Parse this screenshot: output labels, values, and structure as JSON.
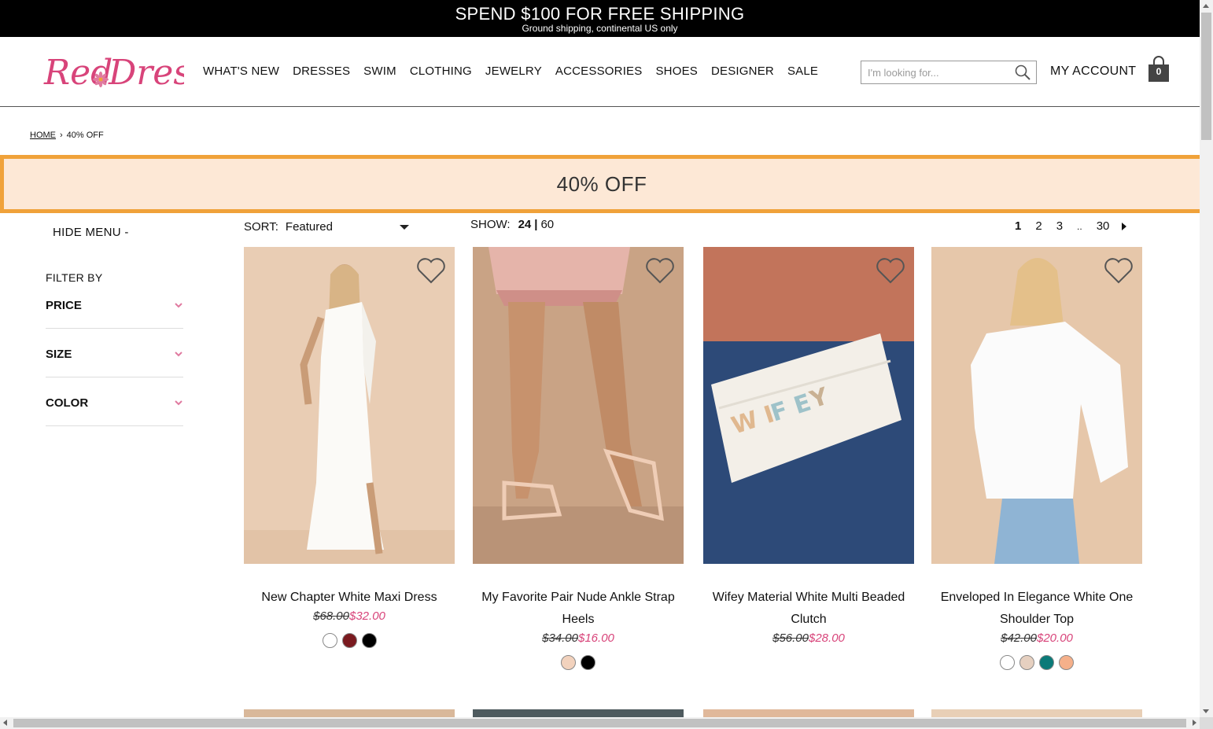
{
  "promo": {
    "headline": "SPEND $100 FOR FREE SHIPPING",
    "subline": "Ground shipping, continental US only"
  },
  "brand": {
    "logo_text": "Red Dress",
    "accent": "#d8447a"
  },
  "nav": [
    "WHAT'S NEW",
    "DRESSES",
    "SWIM",
    "CLOTHING",
    "JEWELRY",
    "ACCESSORIES",
    "SHOES",
    "DESIGNER",
    "SALE"
  ],
  "search": {
    "placeholder": "I'm looking for..."
  },
  "account": {
    "label": "MY ACCOUNT",
    "cart_count": "0"
  },
  "breadcrumb": {
    "home": "HOME",
    "separator": "›",
    "current": "40% OFF"
  },
  "banner": {
    "title": "40% OFF"
  },
  "sidebar": {
    "hide_menu": "HIDE MENU -",
    "filter_by": "FILTER BY",
    "facets": [
      "PRICE",
      "SIZE",
      "COLOR"
    ]
  },
  "toolbar": {
    "sort_label": "SORT:",
    "sort_value": "Featured",
    "show_label": "SHOW:",
    "show_options": [
      "24",
      "|",
      "60"
    ],
    "pages": [
      "1",
      "2",
      "3",
      "..",
      "30"
    ]
  },
  "products": [
    {
      "name": "New Chapter White Maxi Dress",
      "old_price": "$68.00",
      "price": "$32.00",
      "swatches": [
        "#ffffff",
        "#7a1a1f",
        "#000000"
      ]
    },
    {
      "name": "My Favorite Pair Nude Ankle Strap Heels",
      "old_price": "$34.00",
      "price": "$16.00",
      "swatches": [
        "#f2d2bd",
        "#000000"
      ]
    },
    {
      "name": "Wifey Material White Multi Beaded Clutch",
      "old_price": "$56.00",
      "price": "$28.00",
      "swatches": []
    },
    {
      "name": "Enveloped In Elegance White One Shoulder Top",
      "old_price": "$42.00",
      "price": "$20.00",
      "swatches": [
        "#ffffff",
        "#e6d0c0",
        "#0b7a78",
        "#f5b08a"
      ]
    }
  ],
  "icons": {
    "search": "search-icon",
    "bag": "shopping-bag-icon",
    "wishlist": "heart-icon",
    "expand": "chevron-down-icon"
  }
}
